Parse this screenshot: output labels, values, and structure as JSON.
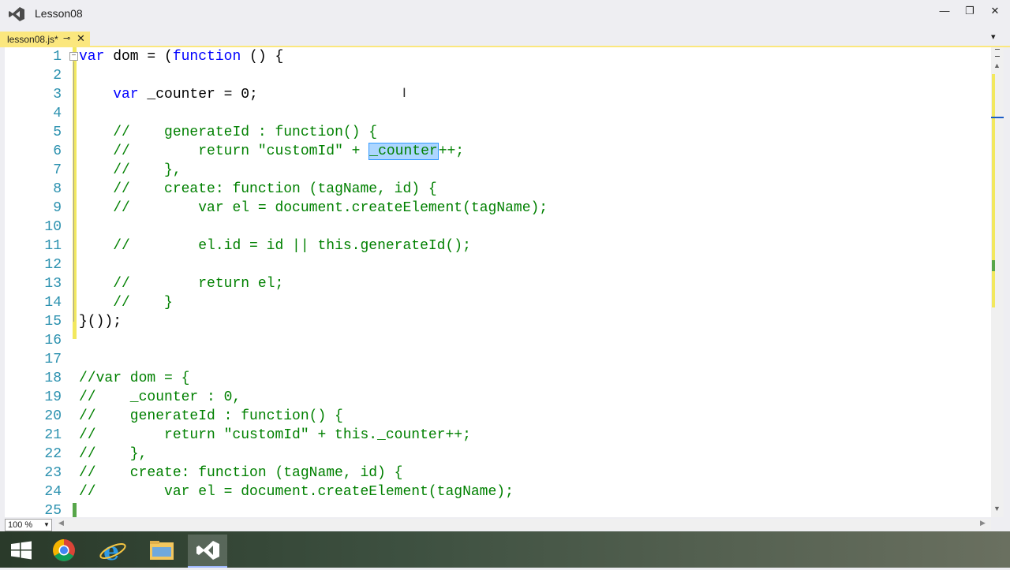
{
  "window": {
    "title": "Lesson08",
    "minimize": "—",
    "restore": "❐",
    "close": "✕"
  },
  "tab": {
    "label": "lesson08.js*",
    "pin": "⊸",
    "close": "✕",
    "dropdown": "▾"
  },
  "editor": {
    "lines": [
      {
        "n": "1",
        "text": "var dom = (function () {"
      },
      {
        "n": "2",
        "text": ""
      },
      {
        "n": "3",
        "text": "    var _counter = 0;"
      },
      {
        "n": "4",
        "text": ""
      },
      {
        "n": "5",
        "text": "    //    generateId : function() {"
      },
      {
        "n": "6",
        "text": "    //        return \"customId\" + _counter++;"
      },
      {
        "n": "7",
        "text": "    //    },"
      },
      {
        "n": "8",
        "text": "    //    create: function (tagName, id) {"
      },
      {
        "n": "9",
        "text": "    //        var el = document.createElement(tagName);"
      },
      {
        "n": "10",
        "text": ""
      },
      {
        "n": "11",
        "text": "    //        el.id = id || this.generateId();"
      },
      {
        "n": "12",
        "text": ""
      },
      {
        "n": "13",
        "text": "    //        return el;"
      },
      {
        "n": "14",
        "text": "    //    }"
      },
      {
        "n": "15",
        "text": "}());"
      },
      {
        "n": "16",
        "text": ""
      },
      {
        "n": "17",
        "text": ""
      },
      {
        "n": "18",
        "text": "//var dom = {"
      },
      {
        "n": "19",
        "text": "//    _counter : 0,"
      },
      {
        "n": "20",
        "text": "//    generateId : function() {"
      },
      {
        "n": "21",
        "text": "//        return \"customId\" + this._counter++;"
      },
      {
        "n": "22",
        "text": "//    },"
      },
      {
        "n": "23",
        "text": "//    create: function (tagName, id) {"
      },
      {
        "n": "24",
        "text": "//        var el = document.createElement(tagName);"
      },
      {
        "n": "25",
        "text": ""
      }
    ],
    "selected_text": "_counter",
    "fold_symbol": "−"
  },
  "statusbar": {
    "zoom": "100 %",
    "zoom_arrow": "▼"
  },
  "colors": {
    "line_number": "#2b91af",
    "keyword": "#0000ff",
    "comment": "#008000",
    "tab_active": "#fbe77e",
    "change_unsaved": "#f2e85e",
    "change_saved": "#57a64a"
  },
  "taskbar": {
    "items": [
      "windows-start-icon",
      "chrome-icon",
      "internet-explorer-icon",
      "file-explorer-icon",
      "visual-studio-icon"
    ]
  }
}
